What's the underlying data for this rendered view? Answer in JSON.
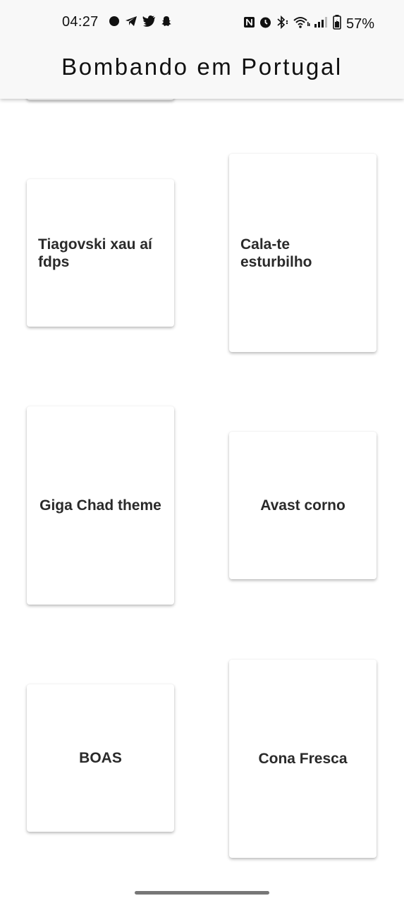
{
  "status_bar": {
    "time": "04:27",
    "left_icons": [
      "signal-app-icon",
      "telegram-icon",
      "twitter-icon",
      "snapchat-icon"
    ],
    "right_icons": [
      "nfc-icon",
      "alarm-icon",
      "bluetooth-icon",
      "wifi-icon",
      "cell-signal-icon",
      "battery-icon"
    ],
    "battery": "57%"
  },
  "header": {
    "title": "Bombando em Portugal"
  },
  "cards": [
    {
      "label": ""
    },
    {
      "label": "Tiagovski xau aí fdps"
    },
    {
      "label": "Cala-te esturbilho"
    },
    {
      "label": "Giga Chad theme"
    },
    {
      "label": "Avast corno"
    },
    {
      "label": "BOAS"
    },
    {
      "label": "Cona Fresca"
    }
  ],
  "colors": {
    "background": "#ffffff",
    "appbar": "#f8f8f8",
    "text": "#2a2a2a"
  }
}
